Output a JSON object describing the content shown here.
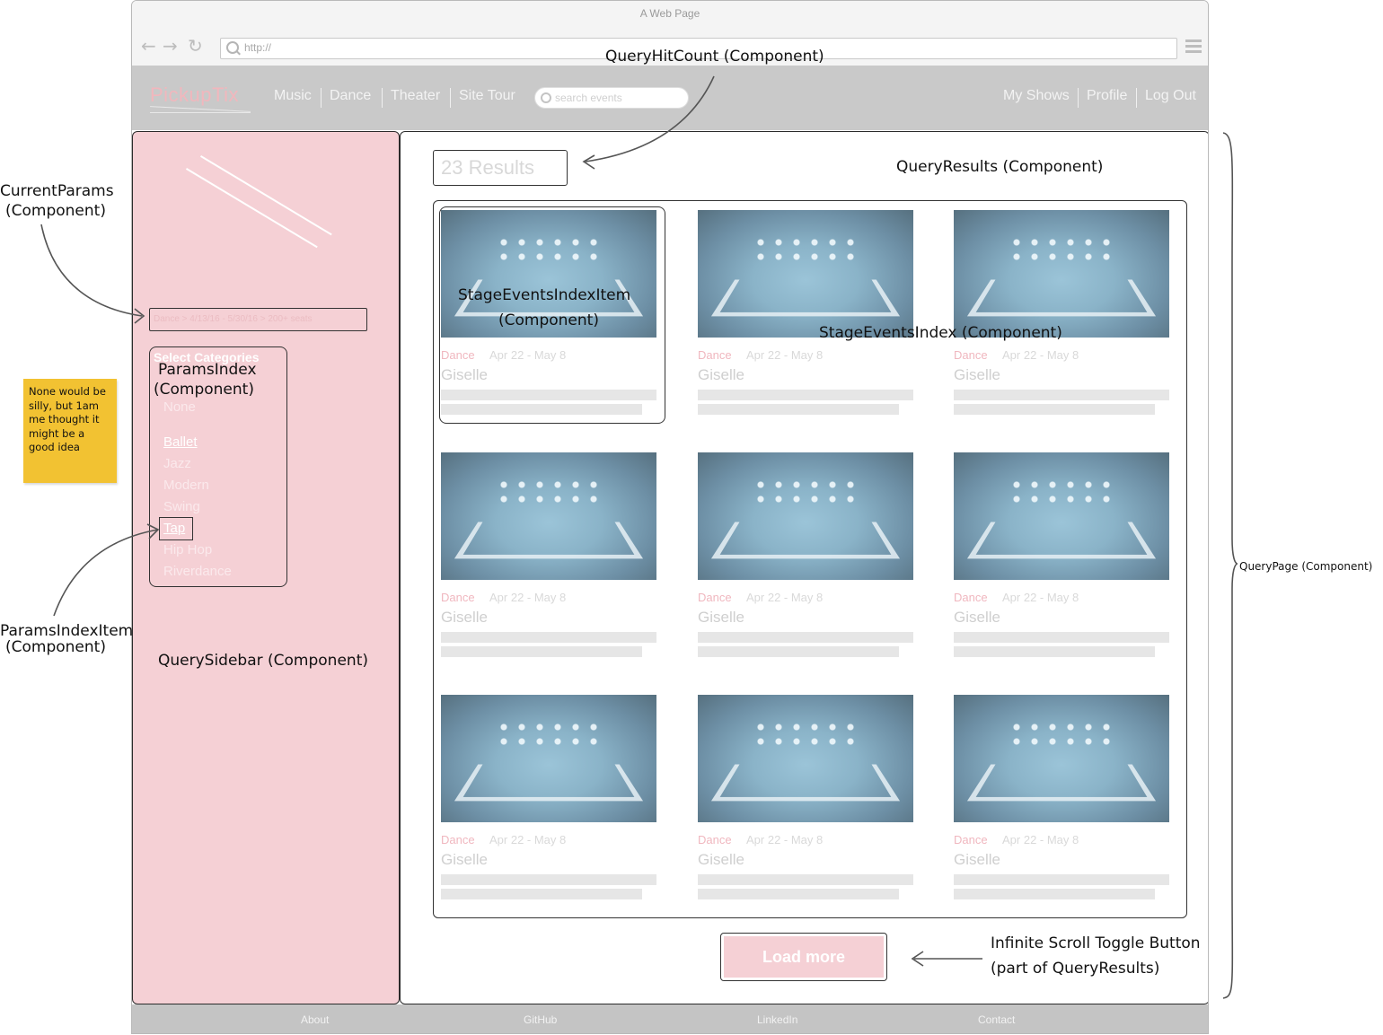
{
  "browser": {
    "window_title": "A Web Page",
    "url": "http://"
  },
  "header": {
    "logo": "PickupTix",
    "nav_left": [
      "Music",
      "Dance",
      "Theater",
      "Site Tour"
    ],
    "search_placeholder": "search events",
    "nav_right": [
      "My Shows",
      "Profile",
      "Log Out"
    ]
  },
  "sidebar": {
    "current_params": "Dance > 4/13/16 - 5/30/16 > 200+ seats",
    "categories_title": "Select Categories",
    "categories": [
      "None",
      "Ballet",
      "Jazz",
      "Modern",
      "Swing",
      "Tap",
      "Hip Hop",
      "Riverdance"
    ],
    "selected": [
      "Ballet",
      "Tap"
    ]
  },
  "results": {
    "hit_count": "23 Results",
    "load_more": "Load more",
    "events": [
      {
        "category": "Dance",
        "dates": "Apr 22 - May 8",
        "title": "Giselle"
      },
      {
        "category": "Dance",
        "dates": "Apr 22 - May 8",
        "title": "Giselle"
      },
      {
        "category": "Dance",
        "dates": "Apr 22 - May 8",
        "title": "Giselle"
      },
      {
        "category": "Dance",
        "dates": "Apr 22 - May 8",
        "title": "Giselle"
      },
      {
        "category": "Dance",
        "dates": "Apr 22 - May 8",
        "title": "Giselle"
      },
      {
        "category": "Dance",
        "dates": "Apr 22 - May 8",
        "title": "Giselle"
      },
      {
        "category": "Dance",
        "dates": "Apr 22 - May 8",
        "title": "Giselle"
      },
      {
        "category": "Dance",
        "dates": "Apr 22 - May 8",
        "title": "Giselle"
      },
      {
        "category": "Dance",
        "dates": "Apr 22 - May 8",
        "title": "Giselle"
      }
    ]
  },
  "footer": {
    "links": [
      "About",
      "GitHub",
      "LinkedIn",
      "Contact"
    ]
  },
  "annotations": {
    "query_hit_count": "QueryHitCount (Component)",
    "query_results": "QueryResults (Component)",
    "current_params": [
      "CurrentParams",
      "(Component)"
    ],
    "params_index": [
      "ParamsIndex",
      "(Component)"
    ],
    "params_index_item": [
      "ParamsIndexItem",
      "(Component)"
    ],
    "query_sidebar": "QuerySidebar (Component)",
    "stage_events_index_item": [
      "StageEventsIndexItem",
      "(Component)"
    ],
    "stage_events_index": "StageEventsIndex (Component)",
    "infinite_scroll": [
      "Infinite Scroll Toggle Button",
      "(part of QueryResults)"
    ],
    "query_page": "QueryPage (Component)",
    "sticky_note": [
      "None would be",
      "silly, but 1am",
      "me thought it",
      "might be a",
      "good idea"
    ]
  },
  "colors": {
    "sidebar_bg": "#f5d0d5",
    "header_bg": "#c9c9c9",
    "sticky_bg": "#f2c232",
    "accent_pink": "#f0b7bf"
  }
}
